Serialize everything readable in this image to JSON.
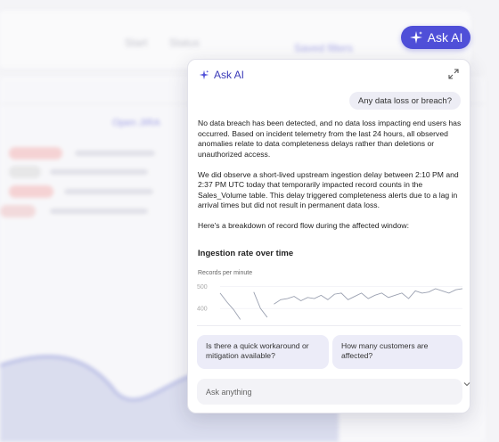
{
  "background": {
    "filter_a": "Start",
    "filter_b": "Status",
    "saved_filters": "Saved filters",
    "link": "Open JIRA"
  },
  "askai_button": {
    "label": "Ask AI",
    "icon": "sparkle-icon"
  },
  "panel": {
    "title": "Ask AI",
    "expand_icon": "expand-icon",
    "user_message": "Any data loss or breach?",
    "reply": [
      "No data breach has been detected, and no data loss impacting end users has occurred. Based on incident telemetry from the last 24 hours, all observed anomalies relate to data completeness delays rather than deletions or unauthorized access.",
      "We did observe a short-lived upstream ingestion delay between 2:10 PM and 2:37 PM UTC today that temporarily impacted record counts in the Sales_Volume table. This delay triggered completeness alerts due to a lag in arrival times but did not result in permanent data loss.",
      "Here's a breakdown of record flow during the affected window:"
    ],
    "suggestions": [
      "Is there a quick workaround or mitigation available?",
      "How many customers are affected?"
    ],
    "input_placeholder": "Ask anything"
  },
  "chart_data": {
    "type": "line",
    "title": "Ingestion rate over time",
    "ylabel": "Records per minute",
    "yticks": [
      500,
      400
    ],
    "ylim": [
      340,
      510
    ],
    "segments": [
      [
        [
          0,
          470
        ],
        [
          1,
          430
        ],
        [
          2,
          395
        ],
        [
          3,
          350
        ]
      ],
      [
        [
          5,
          475
        ],
        [
          6,
          400
        ],
        [
          7,
          360
        ]
      ],
      [
        [
          8,
          420
        ],
        [
          9,
          440
        ],
        [
          10,
          445
        ],
        [
          11,
          455
        ],
        [
          12,
          435
        ],
        [
          13,
          450
        ],
        [
          14,
          445
        ],
        [
          15,
          460
        ],
        [
          16,
          440
        ],
        [
          17,
          465
        ],
        [
          18,
          470
        ],
        [
          19,
          440
        ],
        [
          20,
          455
        ],
        [
          21,
          470
        ],
        [
          22,
          445
        ],
        [
          23,
          460
        ],
        [
          24,
          470
        ],
        [
          25,
          450
        ],
        [
          26,
          460
        ],
        [
          27,
          470
        ],
        [
          28,
          445
        ],
        [
          29,
          480
        ],
        [
          30,
          470
        ],
        [
          31,
          475
        ],
        [
          32,
          490
        ],
        [
          33,
          480
        ],
        [
          34,
          470
        ],
        [
          35,
          485
        ],
        [
          36,
          490
        ]
      ]
    ],
    "color": "#9aa0b0"
  },
  "colors": {
    "accent": "#4f4fd8",
    "accent_text": "#3b3bb8"
  }
}
